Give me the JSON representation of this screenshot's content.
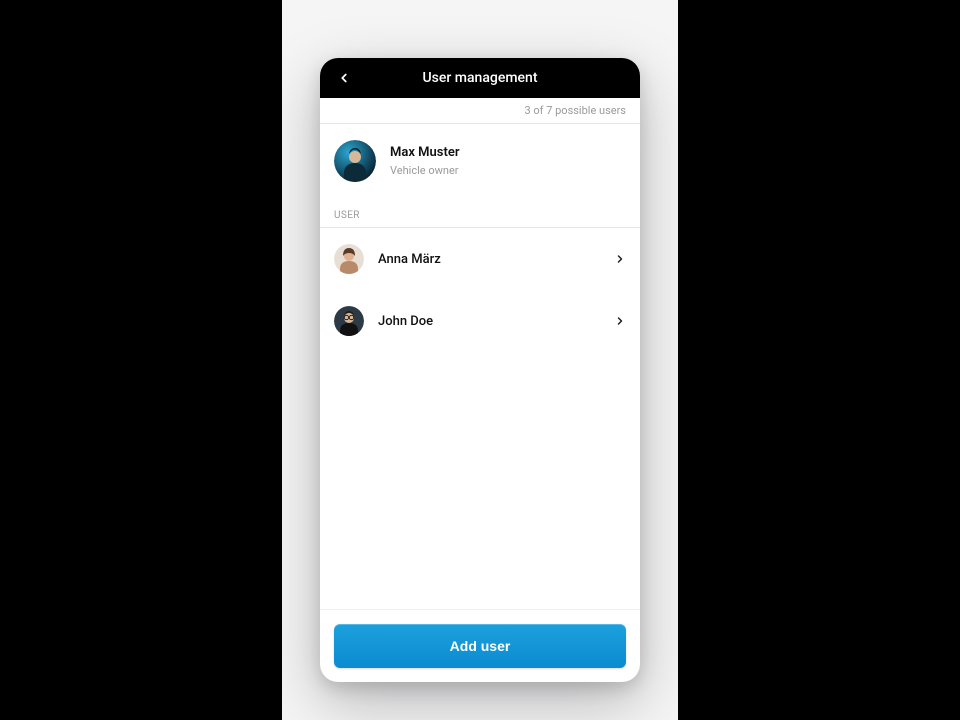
{
  "header": {
    "title": "User management"
  },
  "status": {
    "text": "3 of 7 possible users"
  },
  "owner": {
    "name": "Max Muster",
    "role": "Vehicle owner"
  },
  "section": {
    "label": "USER"
  },
  "users": [
    {
      "name": "Anna März"
    },
    {
      "name": "John Doe"
    }
  ],
  "actions": {
    "add_label": "Add user"
  }
}
